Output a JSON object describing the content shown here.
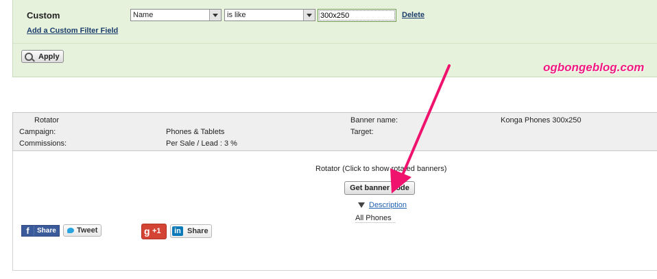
{
  "filter": {
    "custom_label": "Custom",
    "field_select": "Name",
    "operator_select": "is like",
    "value_input": "300x250",
    "delete_link": "Delete",
    "add_field_link": "Add a Custom Filter Field",
    "apply_button": "Apply"
  },
  "watermark": "ogbongeblog.com",
  "banner_info": {
    "type_label": "Rotator",
    "campaign_label": "Campaign:",
    "campaign_value": "Phones & Tablets",
    "commissions_label": "Commissions:",
    "commissions_value": "Per Sale / Lead : 3 %",
    "banner_name_label": "Banner name:",
    "banner_name_value": "Konga Phones 300x250",
    "target_label": "Target:"
  },
  "banner_body": {
    "rotator_caption": "Rotator (Click to show rotated banners)",
    "get_code_button": "Get banner code",
    "description_link": "Description",
    "description_value": "All Phones"
  },
  "social": {
    "facebook_label": "Share",
    "twitter_label": "Tweet",
    "gplus_label": "+1",
    "linkedin_label": "Share"
  },
  "colors": {
    "panel_bg": "#e6f2dc",
    "watermark": "#f11a7e",
    "arrow": "#f0136e"
  }
}
